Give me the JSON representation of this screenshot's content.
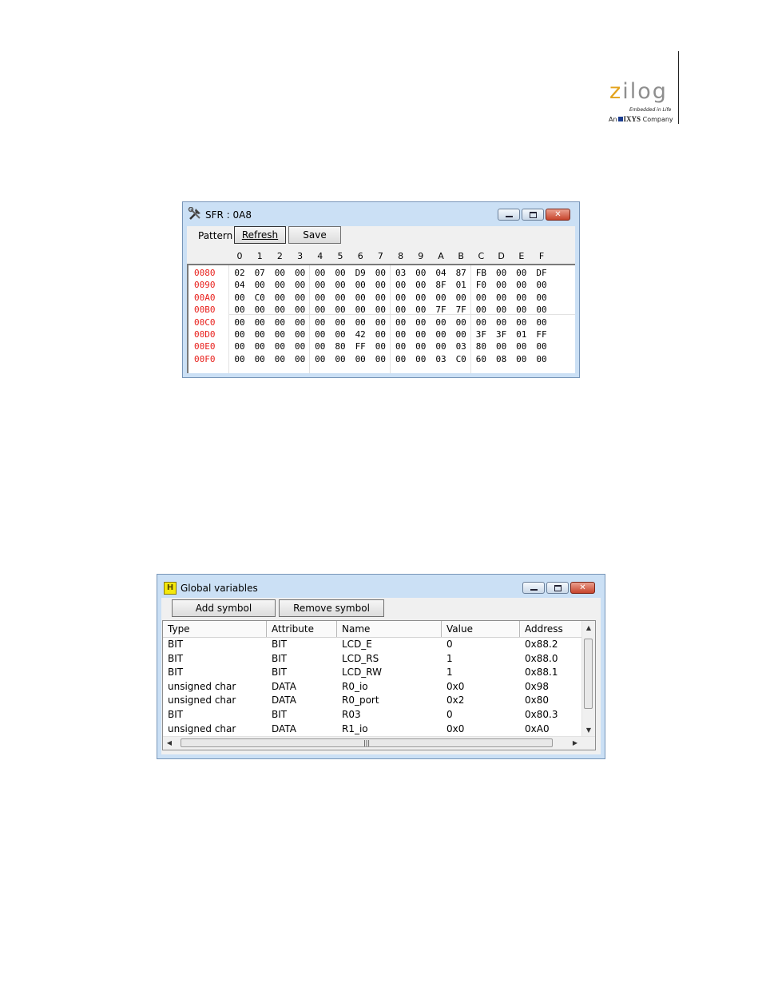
{
  "logo": {
    "wordmark_first": "z",
    "wordmark_rest": "ilog",
    "tagline": "Embedded in Life",
    "company_prefix": "An",
    "company_brand": "IXYS",
    "company_suffix": "Company"
  },
  "sfr_window": {
    "title": "SFR : 0A8",
    "pattern_label": "Pattern",
    "refresh_label": "Refresh",
    "save_label": "Save",
    "column_headers": [
      "0",
      "1",
      "2",
      "3",
      "4",
      "5",
      "6",
      "7",
      "8",
      "9",
      "A",
      "B",
      "C",
      "D",
      "E",
      "F"
    ],
    "rows": [
      {
        "addr": "0080",
        "bytes": [
          "02",
          "07",
          "00",
          "00",
          "00",
          "00",
          "D9",
          "00",
          "03",
          "00",
          "04",
          "87",
          "FB",
          "00",
          "00",
          "DF"
        ]
      },
      {
        "addr": "0090",
        "bytes": [
          "04",
          "00",
          "00",
          "00",
          "00",
          "00",
          "00",
          "00",
          "00",
          "00",
          "8F",
          "01",
          "F0",
          "00",
          "00",
          "00"
        ]
      },
      {
        "addr": "00A0",
        "bytes": [
          "00",
          "C0",
          "00",
          "00",
          "00",
          "00",
          "00",
          "00",
          "00",
          "00",
          "00",
          "00",
          "00",
          "00",
          "00",
          "00"
        ]
      },
      {
        "addr": "00B0",
        "bytes": [
          "00",
          "00",
          "00",
          "00",
          "00",
          "00",
          "00",
          "00",
          "00",
          "00",
          "7F",
          "7F",
          "00",
          "00",
          "00",
          "00"
        ]
      },
      {
        "addr": "00C0",
        "bytes": [
          "00",
          "00",
          "00",
          "00",
          "00",
          "00",
          "00",
          "00",
          "00",
          "00",
          "00",
          "00",
          "00",
          "00",
          "00",
          "00"
        ]
      },
      {
        "addr": "00D0",
        "bytes": [
          "00",
          "00",
          "00",
          "00",
          "00",
          "00",
          "42",
          "00",
          "00",
          "00",
          "00",
          "00",
          "3F",
          "3F",
          "01",
          "FF"
        ]
      },
      {
        "addr": "00E0",
        "bytes": [
          "00",
          "00",
          "00",
          "00",
          "00",
          "80",
          "FF",
          "00",
          "00",
          "00",
          "00",
          "03",
          "80",
          "00",
          "00",
          "00"
        ]
      },
      {
        "addr": "00F0",
        "bytes": [
          "00",
          "00",
          "00",
          "00",
          "00",
          "00",
          "00",
          "00",
          "00",
          "00",
          "03",
          "C0",
          "60",
          "08",
          "00",
          "00"
        ]
      }
    ]
  },
  "globals_window": {
    "title": "Global variables",
    "add_symbol_label": "Add symbol",
    "remove_symbol_label": "Remove symbol",
    "columns": [
      "Type",
      "Attribute",
      "Name",
      "Value",
      "Address"
    ],
    "rows": [
      {
        "type": "BIT",
        "attribute": "BIT",
        "name": "LCD_E",
        "value": "0",
        "address": "0x88.2"
      },
      {
        "type": "BIT",
        "attribute": "BIT",
        "name": "LCD_RS",
        "value": "1",
        "address": "0x88.0"
      },
      {
        "type": "BIT",
        "attribute": "BIT",
        "name": "LCD_RW",
        "value": "1",
        "address": "0x88.1"
      },
      {
        "type": "unsigned char",
        "attribute": "DATA",
        "name": "R0_io",
        "value": "0x0",
        "address": "0x98"
      },
      {
        "type": "unsigned char",
        "attribute": "DATA",
        "name": "R0_port",
        "value": "0x2",
        "address": "0x80"
      },
      {
        "type": "BIT",
        "attribute": "BIT",
        "name": "R03",
        "value": "0",
        "address": "0x80.3"
      },
      {
        "type": "unsigned char",
        "attribute": "DATA",
        "name": "R1_io",
        "value": "0x0",
        "address": "0xA0"
      }
    ]
  },
  "colors": {
    "address_text": "#e8201c",
    "logo_accent": "#e3a31d",
    "logo_grey": "#8e8e8e",
    "window_frame": "#cbe0f5"
  },
  "icons": {
    "sfr_window": "tools-icon",
    "globals_window": "variables-icon",
    "minimize": "minimize-icon",
    "maximize": "maximize-icon",
    "close": "close-icon"
  }
}
